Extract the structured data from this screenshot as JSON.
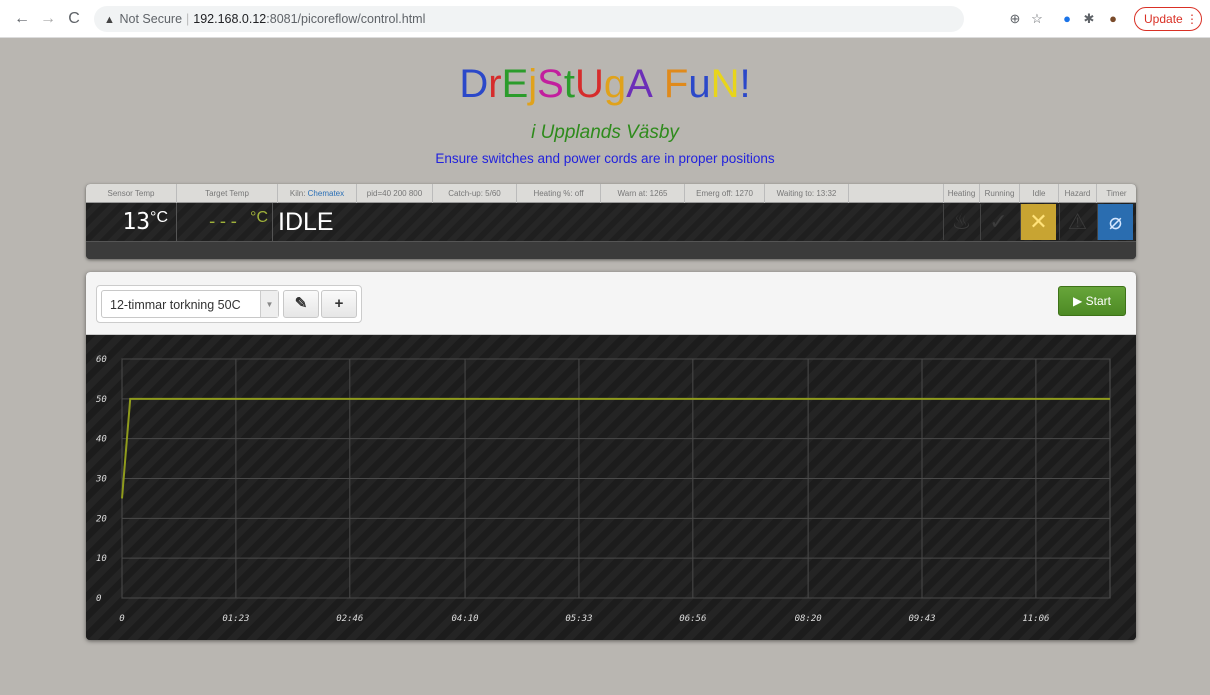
{
  "browser": {
    "security_label": "Not Secure",
    "url_host": "192.168.0.12",
    "url_path": ":8081/picoreflow/control.html",
    "update_label": "Update"
  },
  "header": {
    "title_letters": [
      {
        "ch": "D",
        "color": "#2b48c9"
      },
      {
        "ch": "r",
        "color": "#d62c2c"
      },
      {
        "ch": "E",
        "color": "#2b9c2b"
      },
      {
        "ch": "j",
        "color": "#e0a21b"
      },
      {
        "ch": "S",
        "color": "#c21f9e"
      },
      {
        "ch": "t",
        "color": "#2b9c2b"
      },
      {
        "ch": "U",
        "color": "#d62c2c"
      },
      {
        "ch": "g",
        "color": "#e0a21b"
      },
      {
        "ch": "A",
        "color": "#6c2fb8"
      },
      {
        "ch": " ",
        "color": "#000000"
      },
      {
        "ch": "F",
        "color": "#e08a1b"
      },
      {
        "ch": "u",
        "color": "#2b48c9"
      },
      {
        "ch": "N",
        "color": "#e8d51b"
      },
      {
        "ch": "!",
        "color": "#2b48c9"
      }
    ],
    "subtitle": "i Upplands Väsby",
    "notice": "Ensure switches and power cords are in proper positions"
  },
  "status": {
    "labels": {
      "sensor_temp": "Sensor Temp",
      "target_temp": "Target Temp",
      "kiln_prefix": "Kiln:",
      "kiln_name": "Chematex",
      "pid": "pid=40 200 800",
      "catchup": "Catch-up: 5/60",
      "heating_pct": "Heating %: off",
      "warn": "Warn at: 1265",
      "emerg": "Emerg off: 1270",
      "waiting": "Waiting to: 13:32",
      "heating": "Heating",
      "running": "Running",
      "idle": "Idle",
      "hazard": "Hazard",
      "timer": "Timer"
    },
    "sensor_value": "13",
    "target_value": "---",
    "unit": "°C",
    "state": "IDLE"
  },
  "toolbar": {
    "profile_selected": "12-timmar torkning 50C",
    "edit_icon": "✎",
    "add_icon": "+",
    "start_label": "Start"
  },
  "chart_data": {
    "type": "line",
    "y_ticks": [
      "0",
      "10",
      "20",
      "30",
      "40",
      "50",
      "60"
    ],
    "x_ticks": [
      "0",
      "01:23",
      "02:46",
      "04:10",
      "05:33",
      "06:56",
      "08:20",
      "09:43",
      "11:06"
    ],
    "ylim": [
      0,
      60
    ],
    "x_minutes": [
      0,
      83,
      166,
      250,
      333,
      416,
      500,
      583,
      666
    ],
    "xlim_minutes": [
      0,
      720
    ],
    "grid": true,
    "series": [
      {
        "color": "#8f9b1c",
        "points": [
          [
            0,
            25
          ],
          [
            6,
            50
          ],
          [
            720,
            50
          ]
        ]
      }
    ]
  }
}
